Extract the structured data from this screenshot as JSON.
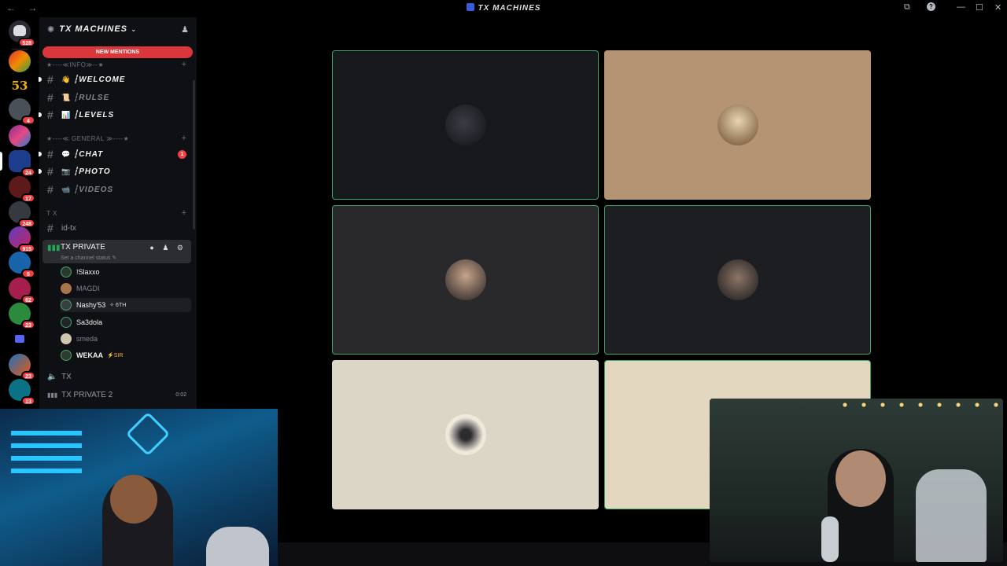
{
  "titlebar": {
    "nav": "← →",
    "title": "TX MACHINES",
    "min": "—",
    "max": "☐",
    "close": "✕",
    "inbox_icon": "⧉",
    "help_icon": "?"
  },
  "guilds": {
    "badges": [
      "528",
      "4",
      "24",
      "17",
      "248",
      "915",
      "5",
      "62",
      "23",
      "23",
      "13"
    ],
    "labels": {
      "fifty_three": "53"
    }
  },
  "server": {
    "name": "TX MACHINES",
    "chevron": "⌄",
    "invite_icon": "user-plus-icon",
    "new_mentions": "NEW MENTIONS"
  },
  "categories": {
    "info": "★----≪INFO≫--★",
    "general": "★----≪ GENERAL ≫----★",
    "tx": "T X",
    "plus": "+",
    "chevron": "⌄"
  },
  "channels": {
    "welcome": {
      "emoji": "👋",
      "name": "┆WELCOME"
    },
    "rules": {
      "emoji": "📜",
      "name": "┆RULSE"
    },
    "levels": {
      "emoji": "📊",
      "name": "┆LEVELS"
    },
    "chat": {
      "emoji": "💬",
      "name": "┆CHAT",
      "badge": "1"
    },
    "photo": {
      "emoji": "📷",
      "name": "┆PHOTO"
    },
    "videos": {
      "emoji": "📹",
      "name": "┆VIDEOS"
    },
    "id_tx": {
      "name": "id-tx"
    },
    "hash": "#"
  },
  "voice": {
    "active": {
      "name": "TX PRIVATE",
      "status": "Set a channel status ✎",
      "icon": "▮▮▮",
      "tools": "● ♟ ⚙"
    },
    "users": [
      {
        "name": "!Slaxxo",
        "tag": ""
      },
      {
        "name": "MAGDI",
        "tag": ""
      },
      {
        "name": "Nashy'53",
        "tag": "✧ 6TH"
      },
      {
        "name": "Sa3dola",
        "tag": ""
      },
      {
        "name": "smeda",
        "tag": ""
      },
      {
        "name": "WEKAA",
        "tag": "⚡SIR"
      }
    ],
    "tx": {
      "icon": "🔈",
      "name": "TX"
    },
    "tx2": {
      "icon": "▮▮▮",
      "name": "TX PRIVATE 2",
      "timer": "0:02"
    }
  },
  "colors": {
    "accent": "#5865f2",
    "speaking": "#3ea56a",
    "mention": "#da373c",
    "online": "#23a55a"
  }
}
